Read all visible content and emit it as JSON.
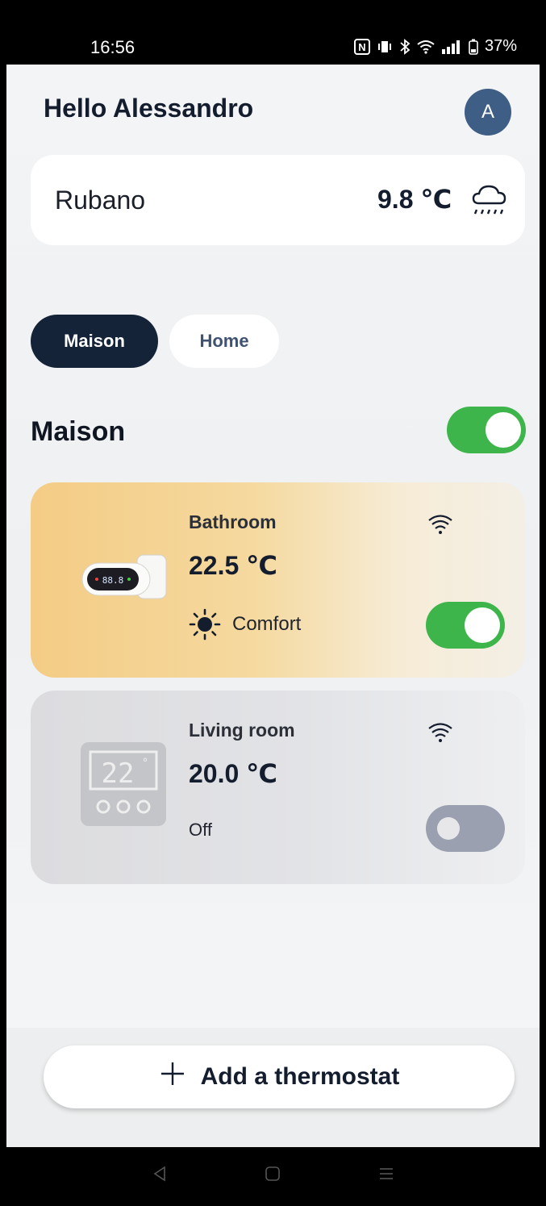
{
  "status_bar": {
    "time": "16:56",
    "nfc": "N",
    "battery": "37%"
  },
  "header": {
    "greeting": "Hello Alessandro",
    "avatar_initial": "A"
  },
  "weather": {
    "city": "Rubano",
    "temperature": "9.8 ℃",
    "icon": "rain-cloud-icon"
  },
  "tabs": [
    {
      "label": "Maison",
      "active": true
    },
    {
      "label": "Home",
      "active": false
    }
  ],
  "section": {
    "title": "Maison",
    "enabled": true
  },
  "thermostats": [
    {
      "name": "Bathroom",
      "temperature": "22.5 ℃",
      "mode": "Comfort",
      "mode_icon": "sun-icon",
      "enabled": true
    },
    {
      "name": "Living room",
      "temperature": "20.0 ℃",
      "mode": "Off",
      "enabled": false,
      "display_value": "22",
      "display_sup": "°"
    }
  ],
  "add_button": {
    "label": "Add a thermostat"
  },
  "colors": {
    "dark_navy": "#152338",
    "toggle_on": "#3db54a",
    "toggle_off": "#9aa0b0",
    "avatar": "#3f5e86"
  }
}
